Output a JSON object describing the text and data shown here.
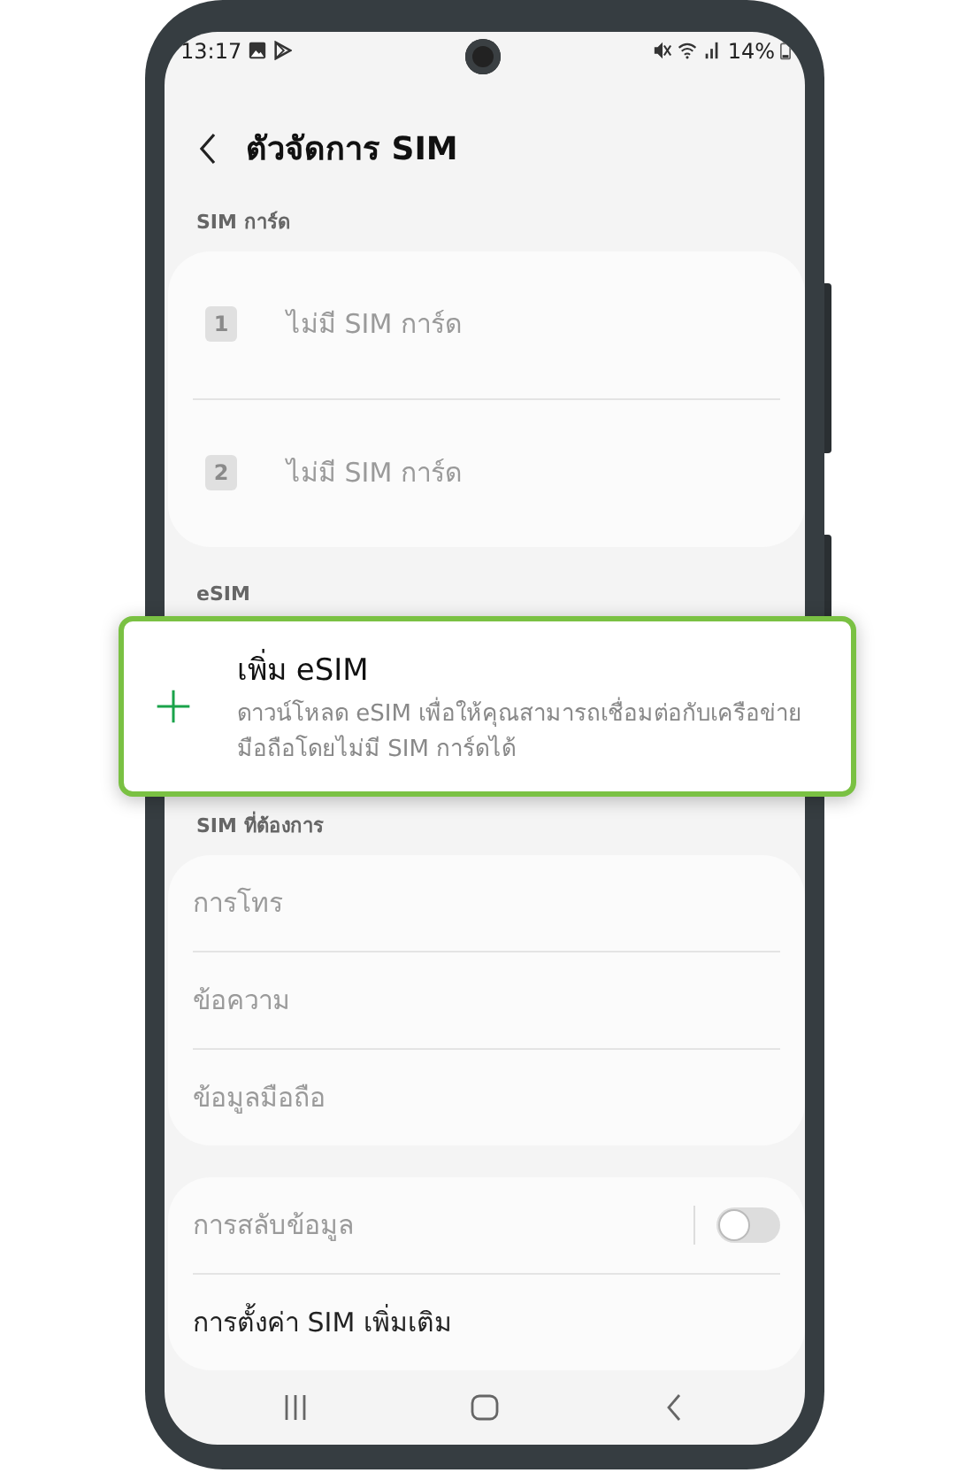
{
  "status_bar": {
    "time": "13:17",
    "battery": "14%"
  },
  "header": {
    "title": "ตัวจัดการ SIM"
  },
  "sim_cards": {
    "heading": "SIM การ์ด",
    "items": [
      {
        "slot": "1",
        "label": "ไม่มี SIM การ์ด",
        "disabled": true
      },
      {
        "slot": "2",
        "label": "ไม่มี SIM การ์ด",
        "disabled": true
      }
    ]
  },
  "esim": {
    "heading": "eSIM",
    "add": {
      "title": "เพิ่ม eSIM",
      "description": "ดาวน์โหลด eSIM เพื่อให้คุณสามารถเชื่อมต่อกับเครือข่ายมือถือโดยไม่มี SIM การ์ดได้"
    }
  },
  "preferred_sim": {
    "heading": "SIM ที่ต้องการ",
    "items": [
      {
        "label": "การโทร",
        "disabled": true
      },
      {
        "label": "ข้อความ",
        "disabled": true
      },
      {
        "label": "ข้อมูลมือถือ",
        "disabled": true
      }
    ]
  },
  "more": {
    "items": [
      {
        "kind": "toggle",
        "label": "การสลับข้อมูล",
        "disabled": true,
        "on": false
      },
      {
        "kind": "link",
        "label": "การตั้งค่า SIM เพิ่มเติม",
        "disabled": false
      }
    ]
  }
}
